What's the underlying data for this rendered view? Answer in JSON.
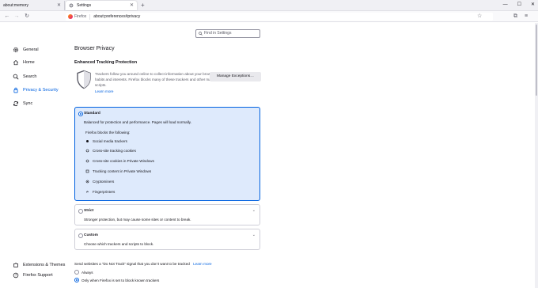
{
  "tabs": [
    {
      "label": "about:memory"
    },
    {
      "label": "Settings"
    }
  ],
  "nav": {
    "identity_label": "Firefox",
    "url": "about:preferences#privacy"
  },
  "search": {
    "placeholder": "Find in Settings"
  },
  "sidebar": {
    "items": [
      {
        "label": "General",
        "icon": "gear-icon"
      },
      {
        "label": "Home",
        "icon": "home-icon"
      },
      {
        "label": "Search",
        "icon": "search-icon"
      },
      {
        "label": "Privacy & Security",
        "icon": "lock-icon",
        "selected": true
      },
      {
        "label": "Sync",
        "icon": "sync-icon"
      }
    ],
    "footer": [
      {
        "label": "Extensions & Themes",
        "icon": "puzzle-icon"
      },
      {
        "label": "Firefox Support",
        "icon": "help-icon"
      }
    ]
  },
  "main": {
    "title": "Browser Privacy",
    "etp_heading": "Enhanced Tracking Protection",
    "etp_description": "Trackers follow you around online to collect information about your browsing habits and interests. Firefox blocks many of these trackers and other malicious scripts.",
    "etp_learn_more": "Learn more",
    "exceptions_button": "Manage Exceptions…",
    "standard": {
      "title": "Standard",
      "subtitle": "Balanced for protection and performance. Pages will load normally.",
      "blocks_label": "Firefox blocks the following:",
      "items": [
        "Social media trackers",
        "Cross-site tracking cookies",
        "Cross-site cookies in Private Windows",
        "Tracking content in Private Windows",
        "Cryptominers",
        "Fingerprinters"
      ]
    },
    "strict": {
      "title": "Strict",
      "subtitle": "Stronger protection, but may cause some sites or content to break."
    },
    "custom": {
      "title": "Custom",
      "subtitle": "Choose which trackers and scripts to block."
    },
    "dnt": {
      "label": "Send websites a “Do Not Track” signal that you don’t want to be tracked",
      "learn_more": "Learn more",
      "options": [
        "Always",
        "Only when Firefox is set to block known trackers"
      ]
    }
  },
  "colors": {
    "accent": "#0061e0",
    "selected_card_bg": "#deeafc"
  }
}
